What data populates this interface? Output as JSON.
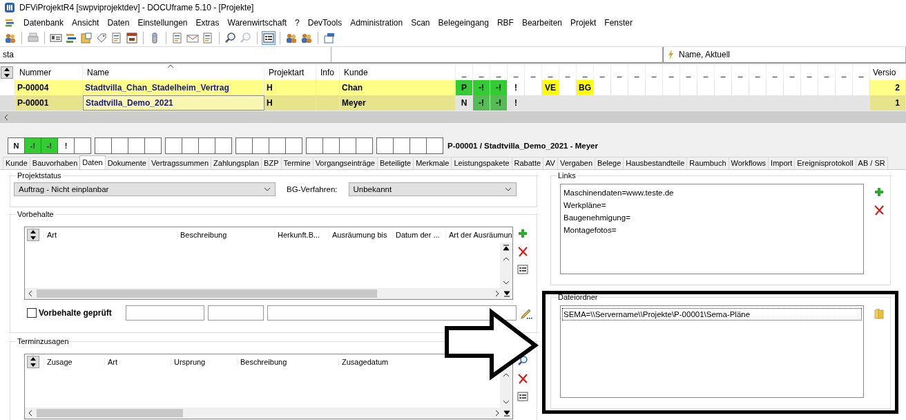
{
  "window": {
    "title": "DFViProjektR4 [swpviprojektdev] - DOCUframe 5.10 - [Projekte]"
  },
  "menu": [
    "Datenbank",
    "Ansicht",
    "Daten",
    "Einstellungen",
    "Extras",
    "Warenwirtschaft",
    "?",
    "DevTools",
    "Administration",
    "Scan",
    "Belegeingang",
    "RBF",
    "Bearbeiten",
    "Projekt",
    "Fenster"
  ],
  "filter": {
    "value": "sta",
    "sort": "Name, Aktuell"
  },
  "grid": {
    "columns": [
      "Nummer",
      "Name",
      "Projektart",
      "Info",
      "Kunde"
    ],
    "flag_columns": [
      "_",
      "_",
      "_",
      "_",
      "_",
      "_",
      "_",
      "_",
      "_",
      "_",
      "_",
      "_",
      "_",
      "_",
      "_",
      "_",
      "_",
      "_",
      "_",
      "_",
      "_",
      "_",
      "_",
      "_"
    ],
    "last_column": "Versio",
    "rows": [
      {
        "selected": false,
        "nummer": "P-00004",
        "name": "Stadtvilla_Chan_Stadelheim_Vertrag",
        "projektart": "H",
        "kunde": "Chan",
        "version": "2",
        "flags": [
          {
            "kind": "mark",
            "text": "P",
            "color": "#33cc33"
          },
          {
            "kind": "mark",
            "text": "-!",
            "color": "#33cc33"
          },
          {
            "kind": "mark",
            "text": "-!",
            "color": "#33cc33"
          },
          {
            "kind": "mark",
            "text": "!"
          },
          {
            "kind": "blank"
          },
          {
            "kind": "mark",
            "text": "VE",
            "color": "#ffff00"
          },
          {
            "kind": "blank"
          },
          {
            "kind": "mark",
            "text": "BG",
            "color": "#ffff00"
          },
          {
            "kind": "blank"
          },
          {
            "kind": "blank"
          },
          {
            "kind": "blank"
          },
          {
            "kind": "blank"
          },
          {
            "kind": "blank"
          },
          {
            "kind": "blank"
          },
          {
            "kind": "blank"
          },
          {
            "kind": "blank"
          },
          {
            "kind": "blank"
          },
          {
            "kind": "blank"
          },
          {
            "kind": "blank"
          },
          {
            "kind": "blank"
          },
          {
            "kind": "blank"
          },
          {
            "kind": "blank"
          },
          {
            "kind": "blank"
          },
          {
            "kind": "blank"
          }
        ]
      },
      {
        "selected": true,
        "nummer": "P-00001",
        "name": "Stadtvilla_Demo_2021",
        "projektart": "H",
        "kunde": "Meyer",
        "version": "1",
        "flags": [
          {
            "kind": "mark",
            "text": "N"
          },
          {
            "kind": "mark",
            "text": "-!",
            "color": "#55bb55"
          },
          {
            "kind": "mark",
            "text": "-!",
            "color": "#55bb55"
          },
          {
            "kind": "mark",
            "text": "!"
          },
          {
            "kind": "blank"
          },
          {
            "kind": "blank"
          },
          {
            "kind": "blank"
          },
          {
            "kind": "blank"
          },
          {
            "kind": "blank"
          },
          {
            "kind": "blank"
          },
          {
            "kind": "blank"
          },
          {
            "kind": "blank"
          },
          {
            "kind": "blank"
          },
          {
            "kind": "blank"
          },
          {
            "kind": "blank"
          },
          {
            "kind": "blank"
          },
          {
            "kind": "blank"
          },
          {
            "kind": "blank"
          },
          {
            "kind": "blank"
          },
          {
            "kind": "blank"
          },
          {
            "kind": "blank"
          },
          {
            "kind": "blank"
          },
          {
            "kind": "blank"
          },
          {
            "kind": "blank"
          }
        ]
      }
    ]
  },
  "detail": {
    "caption": "P-00001 / Stadtvilla_Demo_2021 - Meyer",
    "flags": [
      {
        "kind": "mark",
        "text": "N"
      },
      {
        "kind": "mark",
        "text": "-!",
        "color": "#33cc33"
      },
      {
        "kind": "mark",
        "text": "-!",
        "color": "#33cc33"
      },
      {
        "kind": "mark",
        "text": "!"
      },
      {
        "kind": "blank"
      },
      {
        "kind": "blank"
      },
      {
        "kind": "blank"
      },
      {
        "kind": "blank"
      },
      {
        "kind": "blank"
      },
      {
        "kind": "blank"
      },
      {
        "kind": "blank"
      },
      {
        "kind": "blank"
      },
      {
        "kind": "blank"
      },
      {
        "kind": "blank"
      },
      {
        "kind": "blank"
      },
      {
        "kind": "blank"
      },
      {
        "kind": "blank"
      },
      {
        "kind": "blank"
      },
      {
        "kind": "blank"
      },
      {
        "kind": "blank"
      },
      {
        "kind": "blank"
      },
      {
        "kind": "blank"
      },
      {
        "kind": "blank"
      },
      {
        "kind": "blank"
      },
      {
        "kind": "blank"
      }
    ]
  },
  "tabs": [
    {
      "label": "Kunde",
      "selected": false
    },
    {
      "label": "Bauvorhaben",
      "selected": false
    },
    {
      "label": "Daten",
      "selected": true
    },
    {
      "label": "Dokumente",
      "selected": false
    },
    {
      "label": "Vertragssummen",
      "selected": false
    },
    {
      "label": "Zahlungsplan",
      "selected": false
    },
    {
      "label": "BZP",
      "selected": false
    },
    {
      "label": "Termine",
      "selected": false
    },
    {
      "label": "Vorgangseinträge",
      "selected": false
    },
    {
      "label": "Beteiligte",
      "selected": false
    },
    {
      "label": "Merkmale",
      "selected": false
    },
    {
      "label": "Leistungspakete",
      "selected": false
    },
    {
      "label": "Rabatte",
      "selected": false
    },
    {
      "label": "AV",
      "selected": false
    },
    {
      "label": "Vergaben",
      "selected": false
    },
    {
      "label": "Belege",
      "selected": false
    },
    {
      "label": "Hausbestandteile",
      "selected": false
    },
    {
      "label": "Raumbuch",
      "selected": false
    },
    {
      "label": "Workflows",
      "selected": false
    },
    {
      "label": "Import",
      "selected": false
    },
    {
      "label": "Ereignisprotokoll",
      "selected": false
    },
    {
      "label": "AB / SR",
      "selected": false
    }
  ],
  "projektstatus": {
    "title": "Projektstatus",
    "status": "Auftrag - Nicht einplanbar",
    "bg_label": "BG-Verfahren:",
    "bg_value": "Unbekannt"
  },
  "vorbehalte": {
    "title": "Vorbehalte",
    "columns": [
      "Art",
      "Beschreibung",
      "Herkunft.B...",
      "Ausräumung bis",
      "Datum der ...",
      "Art der Ausräumun"
    ],
    "checkbox": {
      "label": "Vorbehalte geprüft",
      "checked": false
    }
  },
  "terminzusagen": {
    "title": "Terminzusagen",
    "columns": [
      "Zusage",
      "Art",
      "Ursprung",
      "Beschreibung",
      "Zusagedatum"
    ]
  },
  "links": {
    "title": "Links",
    "items": [
      "Maschinendaten=www.teste.de",
      "Werkpläne=",
      "Baugenehmigung=",
      "Montagefotos="
    ]
  },
  "dateiordner": {
    "title": "Dateiordner",
    "items": [
      {
        "text": "SEMA=\\\\Servername\\\\Projekte\\P-00001\\Sema-Pläne",
        "selected": true
      }
    ]
  }
}
